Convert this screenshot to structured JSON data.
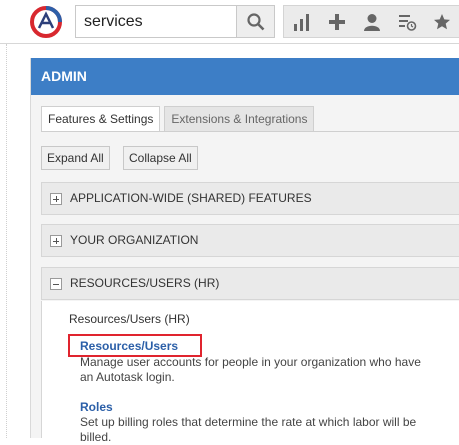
{
  "topbar": {
    "logo": "autotask-logo",
    "search": {
      "value": "services",
      "placeholder": ""
    },
    "icons": [
      "search-icon",
      "bar-chart-icon",
      "plus-icon",
      "user-icon",
      "timesheet-icon",
      "star-icon"
    ]
  },
  "admin": {
    "title": "ADMIN",
    "tabs": [
      {
        "label": "Features & Settings",
        "active": true
      },
      {
        "label": "Extensions & Integrations",
        "active": false
      }
    ],
    "buttons": {
      "expand": "Expand All",
      "collapse": "Collapse All"
    },
    "sections": [
      {
        "title": "APPLICATION-WIDE (SHARED) FEATURES",
        "state": "collapsed"
      },
      {
        "title": "YOUR ORGANIZATION",
        "state": "collapsed"
      },
      {
        "title": "RESOURCES/USERS (HR)",
        "state": "expanded"
      }
    ],
    "resources": {
      "heading": "Resources/Users (HR)",
      "items": [
        {
          "label": "Resources/Users",
          "desc_lines": [
            "Manage user accounts for people in your organization who have",
            "an Autotask login."
          ]
        },
        {
          "label": "Roles",
          "desc_lines": [
            "Set up billing roles that determine the rate at which labor will be",
            "billed."
          ]
        }
      ]
    }
  },
  "colors": {
    "header": "#3d7ec6",
    "link": "#2b5fa8",
    "highlight": "#e0242e"
  }
}
